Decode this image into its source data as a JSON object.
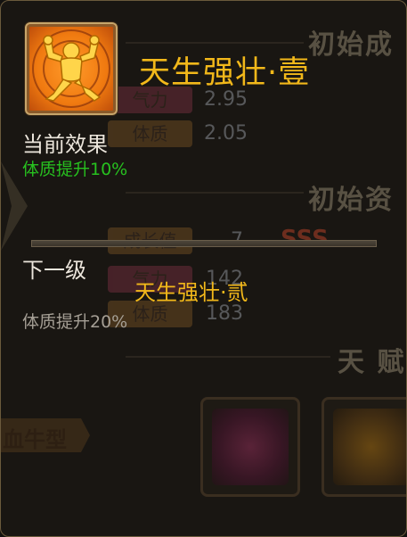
{
  "talent": {
    "title": "天生强壮·壹",
    "current_heading": "当前效果",
    "current_effect": "体质提升10%",
    "next_heading": "下一级",
    "next_name": "天生强壮·贰",
    "next_effect": "体质提升20%"
  },
  "background": {
    "section_initial_growth": "初始成",
    "section_initial_aptitude": "初始资",
    "section_talent": "天 赋",
    "stat_qili_label": "气力",
    "stat_qili_value": "2.95",
    "stat_tizhi_label": "体质",
    "stat_tizhi_value": "2.05",
    "growth_label": "成长值",
    "growth_value": "7",
    "grade": "SSS",
    "apt_qili_label": "气力",
    "apt_qili_value": "142",
    "apt_tizhi_label": "体质",
    "apt_tizhi_value": "183",
    "type_label": "血牛型"
  },
  "colors": {
    "title_gold": "#f2b81a",
    "effect_green": "#27c11f",
    "text_white": "#ece6dc",
    "text_grey": "#a59f95"
  }
}
